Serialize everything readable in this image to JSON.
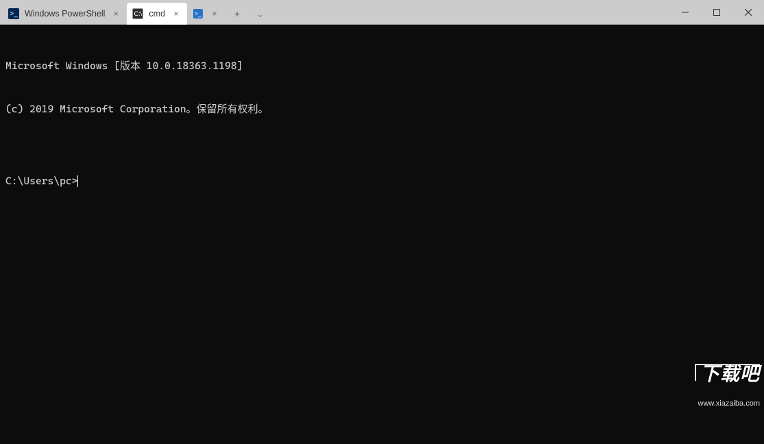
{
  "titlebar": {
    "tabs": [
      {
        "id": "powershell",
        "label": "Windows PowerShell",
        "icon": "powershell-icon",
        "active": false
      },
      {
        "id": "cmd",
        "label": "cmd",
        "icon": "cmd-icon",
        "active": true
      },
      {
        "id": "pwsh",
        "label": "",
        "icon": "pwsh-icon",
        "active": false,
        "icon_only": true
      }
    ],
    "new_tab_glyph": "+",
    "dropdown_glyph": "⌄",
    "close_glyph": "×",
    "window_controls": {
      "minimize": "–",
      "maximize": "☐",
      "close": "✕"
    }
  },
  "terminal": {
    "lines": [
      "Microsoft Windows [版本 10.0.18363.1198]",
      "(c) 2019 Microsoft Corporation。保留所有权利。",
      ""
    ],
    "prompt": "C:\\Users\\pc>",
    "input_value": ""
  },
  "watermark": {
    "big": "下载吧",
    "small": "www.xiazaiba.com"
  }
}
